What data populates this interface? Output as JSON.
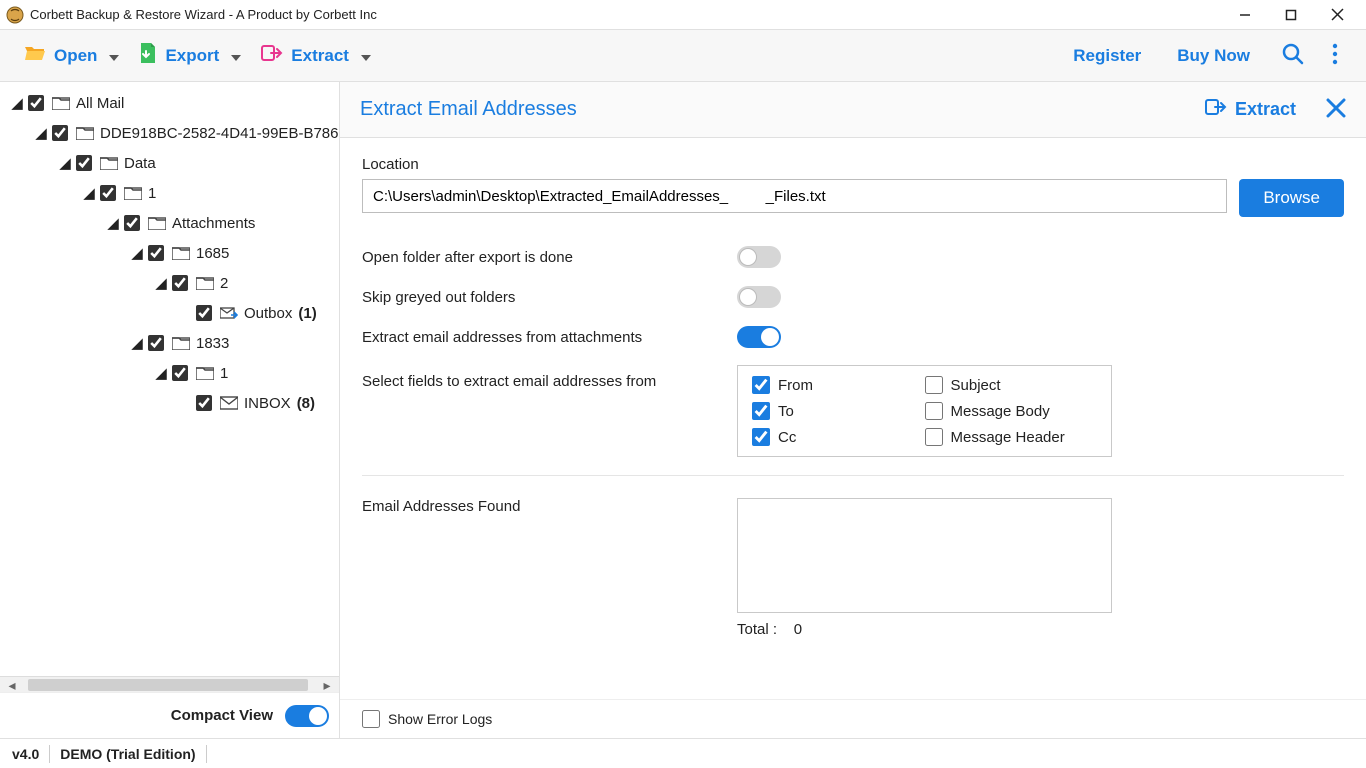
{
  "window": {
    "title": "Corbett Backup & Restore Wizard - A Product by Corbett Inc"
  },
  "toolbar": {
    "open_label": "Open",
    "export_label": "Export",
    "extract_label": "Extract",
    "register_label": "Register",
    "buynow_label": "Buy Now"
  },
  "tree": {
    "root_label": "All Mail",
    "guid_label": "DDE918BC-2582-4D41-99EB-B786",
    "data_label": "Data",
    "n1_label": "1",
    "attachments_label": "Attachments",
    "n1685_label": "1685",
    "n2_label": "2",
    "outbox_label": "Outbox",
    "outbox_count": "(1)",
    "n1833_label": "1833",
    "n1b_label": "1",
    "inbox_label": "INBOX",
    "inbox_count": "(8)"
  },
  "compact": {
    "label": "Compact View"
  },
  "panel": {
    "title": "Extract Email Addresses",
    "extract_btn": "Extract",
    "location_label": "Location",
    "location_value": "C:\\Users\\admin\\Desktop\\Extracted_EmailAddresses_         _Files.txt",
    "browse_label": "Browse",
    "opt_openfolder": "Open folder after export is done",
    "opt_skipgrey": "Skip greyed out folders",
    "opt_attach": "Extract email addresses from attachments",
    "select_fields_label": "Select fields to extract email addresses from",
    "fields": {
      "from": "From",
      "to": "To",
      "cc": "Cc",
      "subject": "Subject",
      "body": "Message Body",
      "header": "Message Header"
    },
    "found_label": "Email Addresses Found",
    "total_label": "Total :",
    "total_value": "0",
    "show_errors_label": "Show Error Logs"
  },
  "status": {
    "version": "v4.0",
    "edition": "DEMO (Trial Edition)"
  }
}
